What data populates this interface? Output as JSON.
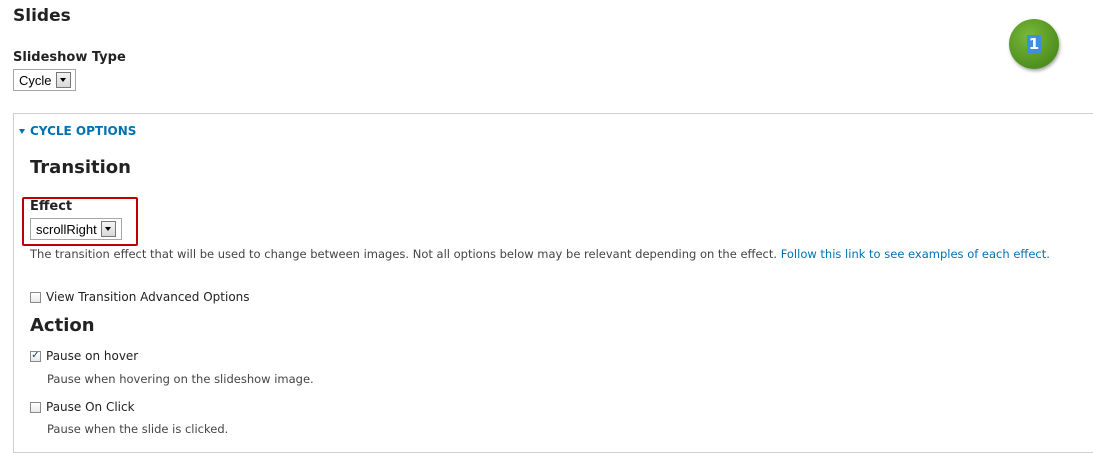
{
  "page": {
    "title": "Slides"
  },
  "slideshow_type": {
    "label": "Slideshow Type",
    "value": "Cycle"
  },
  "badge": {
    "text": "1",
    "color": "#5aa02c"
  },
  "cycle_options": {
    "legend": "CYCLE OPTIONS",
    "transition": {
      "heading": "Transition",
      "effect_label": "Effect",
      "effect_value": "scrollRight",
      "description": "The transition effect that will be used to change between images. Not all options below may be relevant depending on the effect.",
      "link_text": "Follow this link to see examples of each effect.",
      "advanced_label": "View Transition Advanced Options",
      "advanced_checked": false
    },
    "action": {
      "heading": "Action",
      "pause_hover_label": "Pause on hover",
      "pause_hover_checked": true,
      "pause_hover_desc": "Pause when hovering on the slideshow image.",
      "pause_click_label": "Pause On Click",
      "pause_click_checked": false,
      "pause_click_desc": "Pause when the slide is clicked."
    }
  },
  "colors": {
    "link": "#0071b3",
    "highlight": "#c00000"
  }
}
